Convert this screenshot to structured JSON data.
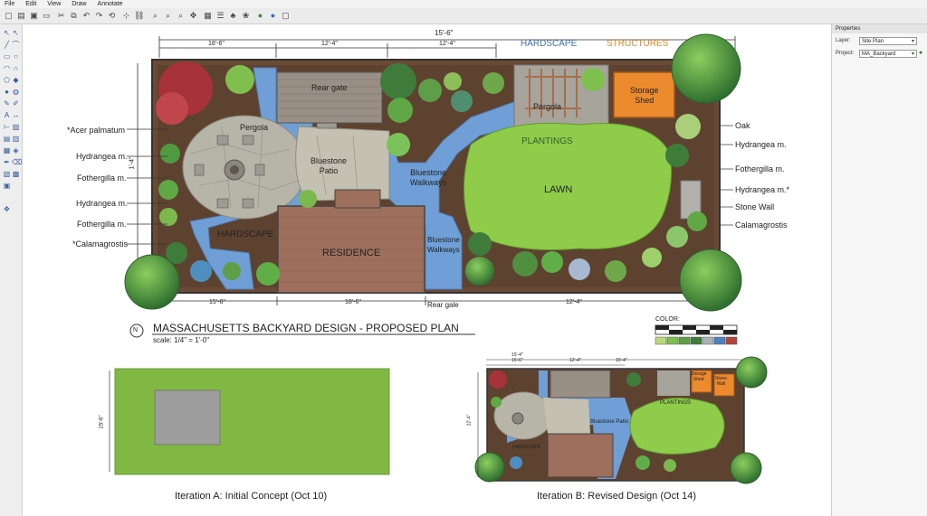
{
  "menu": {
    "file": "File",
    "edit": "Edit",
    "view": "View",
    "draw": "Draw",
    "annotate": "Annotate"
  },
  "properties": {
    "title": "Properties",
    "layer_label": "Layer:",
    "layer_value": "Site Plan",
    "project_label": "Project:",
    "project_value": "MA_Backyard"
  },
  "plan": {
    "title": "MASSACHUSETTS BACKYARD DESIGN - PROPOSED PLAN",
    "scale": "scale: 1/4\" = 1'-0\"",
    "north": "N",
    "overall_dim": "15'-6\"",
    "top_dims": [
      "18'-6\"",
      "12'-4\"",
      "12'-4\""
    ],
    "bottom_dims": [
      "15'-6\"",
      "18'-6\"",
      "12'-4\""
    ],
    "side_dim": "1'-4\"",
    "headers": {
      "hardscape": "HARDSCAPE",
      "structures": "STRUCTURES"
    },
    "areas": {
      "rear_gate_top": "Rear gate",
      "pergola_left": "Pergola",
      "pergola_right": "Pergola",
      "bluestone_patio": "Bluestone\nPatio",
      "bluestone_walkways_1": "Bluestone\nWalkways",
      "bluestone_walkways_2": "Bluestone\nWalkways",
      "hardscape": "HARDSCAPE",
      "residence": "RESIDENCE",
      "rear_gate_bottom": "Rear gale",
      "plantings": "PLANTINGS",
      "lawn": "LAWN",
      "storage_shed": "Storage\nShed"
    },
    "left_labels": [
      "*Acer palmatum",
      "Hydrangea m.",
      "Fothergilla m.",
      "Hydrangea m.",
      "Fothergilla m.",
      "*Calamagrostis"
    ],
    "right_labels": [
      "Oak",
      "Hydrangea m.",
      "Fothergilla m.",
      "Hydrangea m.*",
      "Stone Wall",
      "Calamagrostis"
    ],
    "color_label": "COLOR:",
    "palette": [
      "#b9d97a",
      "#7fbf4e",
      "#5f9e49",
      "#3f7c3c",
      "#a9b2b8",
      "#4f7fc0",
      "#b3453a"
    ]
  },
  "iterations": {
    "a": {
      "caption": "Iteration A: Initial Concept (Oct 10)",
      "side_dim": "15'-6\""
    },
    "b": {
      "caption": "Iteration B: Revised Design (Oct 14)",
      "top_dims": [
        "15'-6\"",
        "12'-4\"",
        "15'-4\""
      ],
      "overall_dim": "15'-4\"",
      "side_dim": "12'-4\"",
      "labels": {
        "storage_shed": "Storage\nShed",
        "stone_wall": "Stone\nWall",
        "plantings": "PLANTINGS",
        "bluestone_patio": "Bluestone Patio",
        "hardscape": "HARDSCAPE"
      }
    }
  }
}
